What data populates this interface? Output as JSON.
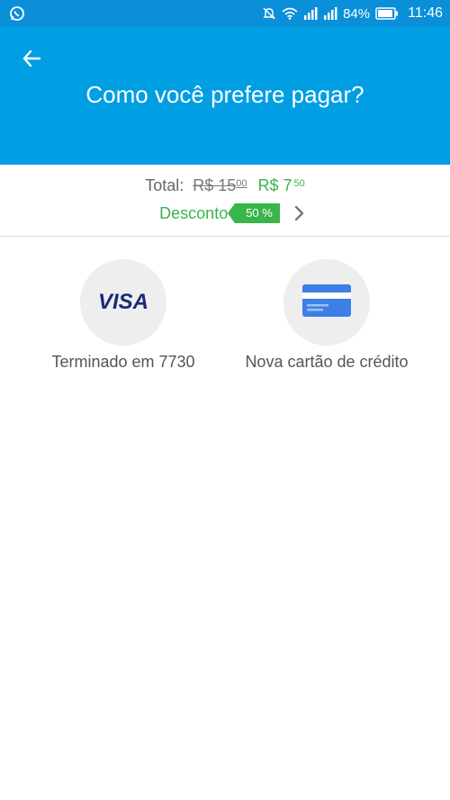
{
  "status_bar": {
    "battery": "84%",
    "time": "11:46"
  },
  "header": {
    "title": "Como você prefere pagar?"
  },
  "summary": {
    "total_label": "Total:",
    "old_price": "R$ 15",
    "old_cents": "00",
    "new_price": "R$ 7",
    "new_cents": "50",
    "discount_label": "Desconto",
    "discount_badge": "50 %"
  },
  "payment_methods": [
    {
      "logo_text": "VISA",
      "label": "Terminado em 7730"
    },
    {
      "label": "Nova cartão de crédito"
    }
  ],
  "colors": {
    "status_bar": "#0a8fd8",
    "app_bar": "#009ee3",
    "discount_green": "#39b54a",
    "visa_blue": "#1a2a7a",
    "card_blue": "#3d7fe6"
  }
}
